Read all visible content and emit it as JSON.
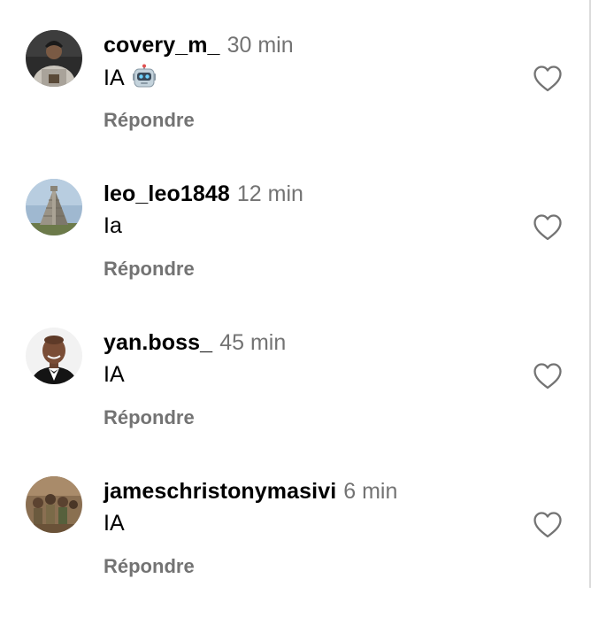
{
  "comments": [
    {
      "username": "covery_m_",
      "time": "30 min",
      "text": "IA",
      "emoji": "robot",
      "avatar": "man-in-jacket",
      "reply_label": "Répondre",
      "like_icon": "heart-outline-icon"
    },
    {
      "username": "leo_leo1848",
      "time": "12 min",
      "text": "Ia",
      "avatar": "pyramid",
      "reply_label": "Répondre",
      "like_icon": "heart-outline-icon"
    },
    {
      "username": "yan.boss_",
      "time": "45 min",
      "text": "IA",
      "avatar": "man-in-tuxedo",
      "reply_label": "Répondre",
      "like_icon": "heart-outline-icon"
    },
    {
      "username": "jameschristonymasivi",
      "time": "6 min",
      "text": "IA",
      "avatar": "group-photo",
      "reply_label": "Répondre",
      "like_icon": "heart-outline-icon"
    }
  ],
  "colors": {
    "username": "#000000",
    "secondary_text": "#737373",
    "icon_stroke": "#737373",
    "divider": "#dbdbdb"
  }
}
